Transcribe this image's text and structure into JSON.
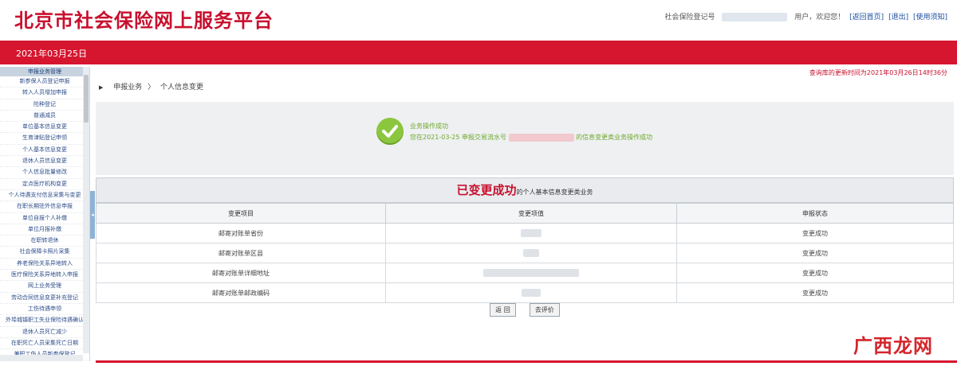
{
  "header": {
    "title": "北京市社会保险网上服务平台",
    "user_label": "社会保险登记号",
    "welcome": "用户，欢迎您！",
    "links": [
      "[返回首页]",
      "[退出]",
      "[使用须知]"
    ]
  },
  "datebar": {
    "date": "2021年03月25日"
  },
  "sidebar": {
    "header": "申报业务管理",
    "items": [
      "新参保人员登记申报",
      "转入人员增加申报",
      "险种登记",
      "普通减员",
      "单位基本信息变更",
      "生育津贴登记申领",
      "个人基本信息变更",
      "退休人员信息变更",
      "个人信息批量修改",
      "定点医疗机构变更",
      "个人待遇支付信息采集与变更",
      "在职长期驻外信息申报",
      "单位自报个人补缴",
      "单位月报补缴",
      "在职转退休",
      "社会保障卡照片采集",
      "养老保险关系异地转入",
      "医疗保险关系异地转入申报",
      "网上业务受理",
      "劳动合同信息变更补充登记",
      "工伤待遇申领",
      "外埠城镇职工失业保险待遇确认",
      "退休人员死亡减少",
      "在职死亡人员采集死亡日期",
      "兼职工伤人员新参保登记"
    ]
  },
  "main": {
    "update_note": "查询库的更新时间为2021年03月26日14时36分",
    "breadcrumb": [
      "申报业务",
      "个人信息变更"
    ],
    "success": {
      "title": "业务操作成功",
      "line_prefix": "您在2021-03-25 申报交易流水号",
      "line_suffix": "的信息变更类业务操作成功"
    },
    "table": {
      "title_big": "已变更成功",
      "title_rest": "的个人基本信息变更类业务",
      "headers": [
        "变更项目",
        "变更项值",
        "申报状态"
      ],
      "rows": [
        {
          "item": "邮寄对账单省份",
          "status": "变更成功"
        },
        {
          "item": "邮寄对账单区县",
          "status": "变更成功"
        },
        {
          "item": "邮寄对账单详细地址",
          "status": "变更成功"
        },
        {
          "item": "邮寄对账单邮政编码",
          "status": "变更成功"
        }
      ]
    },
    "buttons": [
      "返 回",
      "去评价"
    ]
  },
  "watermark": "广西龙网",
  "colors": {
    "brand_red": "#d6152e",
    "success_green": "#8cc63f",
    "link_blue": "#1a4ea0"
  }
}
